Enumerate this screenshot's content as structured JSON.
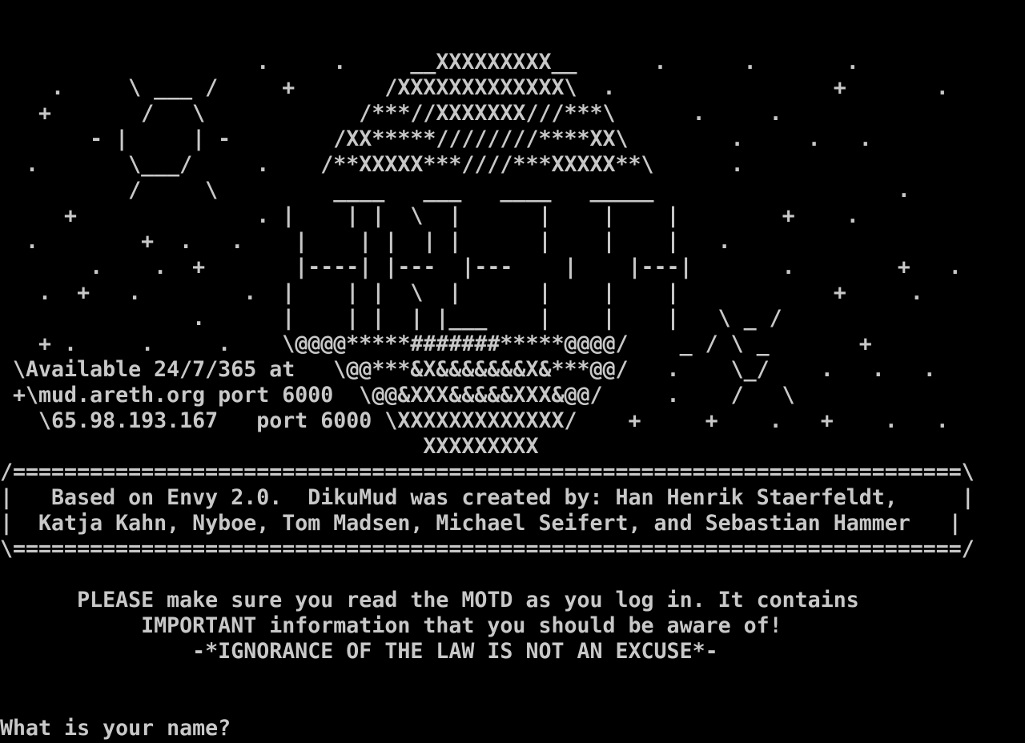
{
  "terminal": {
    "background": "#000000",
    "foreground": "#c8c8c8",
    "banner_lines": [
      "                    .     .     __XXXXXXXXX__      .      .       .",
      "    .     \\ ___ /     +       /XXXXXXXXXXXXX\\  .                 +       .",
      "   +       /   \\            /***//XXXXXXX///***\\      .     .",
      "       - |     | -        /XX*****////////****XX\\        .     .   .",
      "  .       \\___/     .    /**XXXXX***////***XXXXX**\\      .",
      "          /     \\         ____   ___   ____   _____                   .",
      "     +              . |    | |  \\  |      |    |    |        +    .",
      "  .        +  .   .    |    | |  | |      |    |    |   .",
      "       .    .  +       |----| |---  |---    |    |---|       .        +   .",
      "   .  +   .        .  |    | |  \\  |      |    |    |            +     .",
      "               .      |    | |  | |___    |    |    |   \\ _ /",
      "   + .     .     .    \\@@@@*****#######*****@@@@/    _ / \\ _       +",
      " \\Available 24/7/365 at   \\@@***&X&&&&&&&X&***@@/   .    \\_/    .   .   .",
      " +\\mud.areth.org port 6000  \\@@&XXX&&&&&XXX&@@/     .    /   \\",
      "   \\65.98.193.167   port 6000 \\XXXXXXXXXXXXX/    +     +    .   +    .   .",
      "                                 XXXXXXXXX",
      "/==========================================================================\\",
      "|   Based on Envy 2.0.  DikuMud was created by: Han Henrik Staerfeldt,     |",
      "|  Katja Kahn, Nyboe, Tom Madsen, Michael Seifert, and Sebastian Hammer   |",
      "\\==========================================================================/",
      "",
      "      PLEASE make sure you read the MOTD as you log in. It contains",
      "           IMPORTANT information that you should be aware of!",
      "               -*IGNORANCE OF THE LAW IS NOT AN EXCUSE*-"
    ],
    "prompt": "What is your name?"
  }
}
